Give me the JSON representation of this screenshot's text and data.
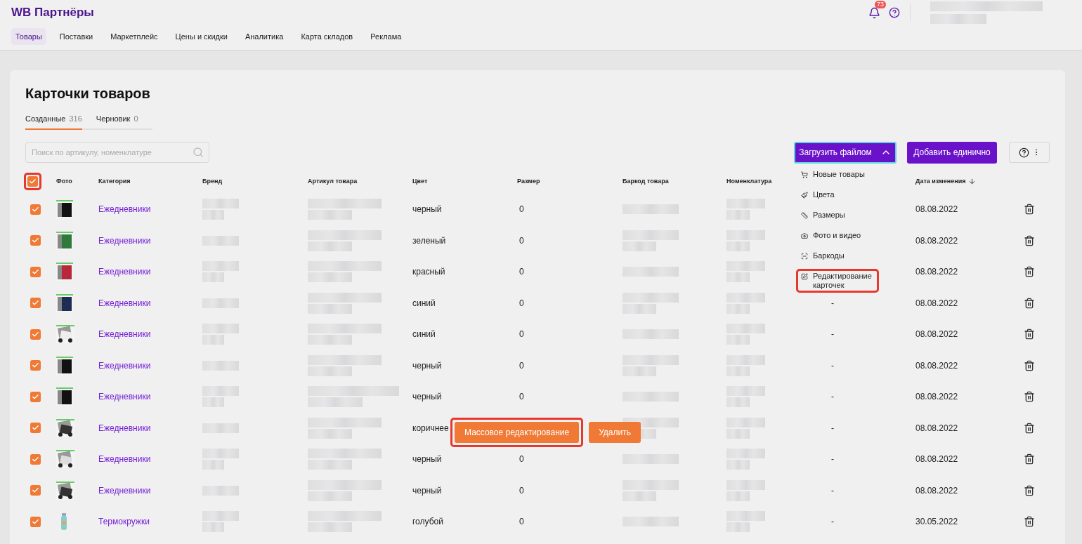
{
  "header": {
    "logo": "WB Партнёры",
    "notifications": {
      "count": "73"
    },
    "nav": [
      {
        "label": "Товары",
        "selected": true
      },
      {
        "label": "Поставки",
        "selected": false
      },
      {
        "label": "Маркетплейс",
        "selected": false
      },
      {
        "label": "Цены и скидки",
        "selected": false
      },
      {
        "label": "Аналитика",
        "selected": false
      },
      {
        "label": "Карта складов",
        "selected": false
      },
      {
        "label": "Реклама",
        "selected": false
      }
    ]
  },
  "page": {
    "title": "Карточки товаров",
    "tabs": [
      {
        "label": "Созданные",
        "count": "316",
        "selected": true
      },
      {
        "label": "Черновик",
        "count": "0",
        "selected": false
      }
    ],
    "search": {
      "placeholder": "Поиск по артикулу, номенклатуре"
    },
    "upload_button": {
      "label": "Загрузить файлом",
      "expanded": true
    },
    "add_button": {
      "label": "Добавить единично"
    },
    "upload_menu": [
      {
        "label": "Новые товары",
        "highlighted": false
      },
      {
        "label": "Цвета",
        "highlighted": false
      },
      {
        "label": "Размеры",
        "highlighted": false
      },
      {
        "label": "Фото и видео",
        "highlighted": false
      },
      {
        "label": "Баркоды",
        "highlighted": false
      },
      {
        "label": "Редактирование карточек",
        "highlighted": true
      }
    ],
    "table": {
      "select_all": {
        "checked": true,
        "highlighted": true
      },
      "columns": [
        "Фото",
        "Категория",
        "Бренд",
        "Артикул товара",
        "Цвет",
        "Размер",
        "Баркод товара",
        "Номенклатура",
        "Дата изменения"
      ],
      "rows": [
        {
          "checked": true,
          "category": "Ежедневники",
          "colour_name": "черный",
          "size": "0",
          "date": "08.08.2022"
        },
        {
          "checked": true,
          "category": "Ежедневники",
          "colour_name": "зеленый",
          "size": "0",
          "date": "08.08.2022"
        },
        {
          "checked": true,
          "category": "Ежедневники",
          "colour_name": "красный",
          "size": "0",
          "date": "08.08.2022"
        },
        {
          "checked": true,
          "category": "Ежедневники",
          "colour_name": "синий",
          "size": "0",
          "column_9": "-",
          "date": "08.08.2022"
        },
        {
          "checked": true,
          "category": "Ежедневники",
          "colour_name": "синий",
          "size": "0",
          "column_9": "-",
          "date": "08.08.2022"
        },
        {
          "checked": true,
          "category": "Ежедневники",
          "colour_name": "черный",
          "size": "0",
          "column_9": "-",
          "date": "08.08.2022"
        },
        {
          "checked": true,
          "category": "Ежедневники",
          "colour_name": "черный",
          "size": "0",
          "column_9": "-",
          "date": "08.08.2022"
        },
        {
          "checked": true,
          "category": "Ежедневники",
          "colour_name": "коричнее",
          "column_9": "-",
          "date": "08.08.2022"
        },
        {
          "checked": true,
          "category": "Ежедневники",
          "colour_name": "черный",
          "size": "0",
          "column_9": "-",
          "date": "08.08.2022"
        },
        {
          "checked": true,
          "category": "Ежедневники",
          "colour_name": "черный",
          "size": "0",
          "column_9": "-",
          "date": "08.08.2022"
        },
        {
          "checked": true,
          "category": "Термокружки",
          "colour_name": "голубой",
          "size": "0",
          "column_9": "-",
          "date": "30.05.2022"
        }
      ]
    },
    "bulk_actions": [
      {
        "label": "Массовое редактирование",
        "highlighted": true
      },
      {
        "label": "Удалить",
        "highlighted": false
      }
    ]
  }
}
